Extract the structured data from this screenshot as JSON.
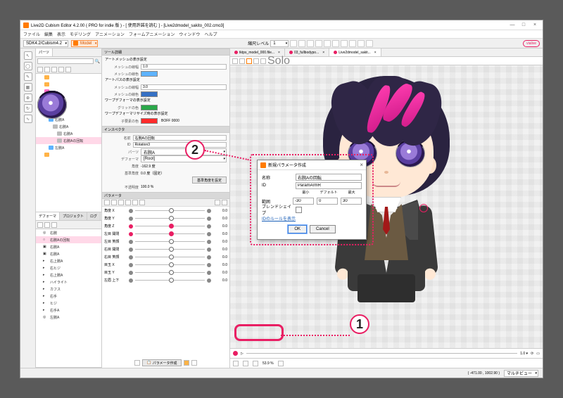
{
  "window": {
    "title": "Live2D Cubism Editor 4.2.00   ( PRO for indie 版 ) - [ 使用許諾を読む ]   - [Live2dmodel_sakito_002.cmo3]",
    "minimize": "—",
    "maximize": "□",
    "close": "×"
  },
  "menu": [
    "ファイル",
    "編集",
    "表示",
    "モデリング",
    "アニメーション",
    "フォームアニメーション",
    "ウィンドウ",
    "ヘルプ"
  ],
  "toolbar": {
    "sdk": "SDK4.2/Cubism4.2",
    "mode": "Model",
    "zoomlabel": "縮尺レベル",
    "zoomval": "1",
    "vialive": "vialive"
  },
  "parts_panel": {
    "tab": "パーツ",
    "search_ph": "",
    "tree": [
      {
        "lbl": "",
        "color": "folder"
      },
      {
        "lbl": "",
        "color": "folder"
      },
      {
        "lbl": "",
        "color": "pink"
      },
      {
        "lbl": "",
        "color": "folder"
      },
      {
        "lbl": "",
        "color": "folder"
      },
      {
        "lbl": "",
        "color": "folder"
      },
      {
        "lbl": "右腕A",
        "color": "blue",
        "indent": 1
      },
      {
        "lbl": "右腕A",
        "color": "gray",
        "indent": 2
      },
      {
        "lbl": "右腕A",
        "color": "gray",
        "indent": 3
      },
      {
        "lbl": "右腕Aの回転",
        "color": "gray",
        "indent": 3,
        "sel": true
      },
      {
        "lbl": "左腕A",
        "color": "blue",
        "indent": 1
      },
      {
        "lbl": "",
        "color": "folder"
      }
    ]
  },
  "deformer_panel": {
    "tabs": [
      "デフォーマ",
      "プロジェクト",
      "ログ"
    ],
    "tree": [
      {
        "lbl": "右腕",
        "ic": "◎"
      },
      {
        "lbl": "右腕Aの回転",
        "ic": "○",
        "sel": true
      },
      {
        "lbl": "右腕A",
        "ic": "▣"
      },
      {
        "lbl": "右腕A",
        "ic": "▣"
      },
      {
        "lbl": "右上腕A",
        "ic": "▸"
      },
      {
        "lbl": "右ヒジ",
        "ic": "▸"
      },
      {
        "lbl": "右上腕A",
        "ic": "▸"
      },
      {
        "lbl": "ハイライト",
        "ic": "▸"
      },
      {
        "lbl": "カフス",
        "ic": "▸"
      },
      {
        "lbl": "右手",
        "ic": "▸"
      },
      {
        "lbl": "ヒジ",
        "ic": "▸"
      },
      {
        "lbl": "右手A",
        "ic": "▸"
      },
      {
        "lbl": "左腕A",
        "ic": "◎"
      }
    ]
  },
  "tooldetail": {
    "title": "ツール詳細",
    "group1": "アートメッシュの表示設定",
    "rows1": [
      {
        "k": "メッシュの線幅",
        "v": "1.0"
      },
      {
        "k": "メッシュの線色",
        "v": ""
      }
    ],
    "group2": "アートパスの表示設定",
    "rows2": [
      {
        "k": "メッシュの線幅",
        "v": "3.0"
      },
      {
        "k": "メッシュの線色",
        "v": ""
      }
    ],
    "group3": "ワープデフォーマの表示設定",
    "rows3": [
      {
        "k": "グリッドの色",
        "v": ""
      }
    ],
    "group4": "ワープデフォーマリサイズ時の表示設定",
    "rows4": [
      {
        "k": "子要素の色",
        "v": "#bff000",
        "hex": "BOFF 0000"
      }
    ]
  },
  "inspector": {
    "title": "インスペクタ",
    "rows": [
      {
        "k": "名前",
        "v": "右腕Aの回転"
      },
      {
        "k": "ID",
        "v": "Rotation3"
      },
      {
        "k": "パーツ",
        "v": "右腕A"
      },
      {
        "k": "デフォーマ",
        "v": "[Root]"
      },
      {
        "k": "角度",
        "v": "-162.9 度"
      },
      {
        "k": "基準角度",
        "v": "0.0 度（固定）"
      }
    ],
    "btn": "基準角度を設定",
    "opacity_k": "不透明度",
    "opacity_v": "100.0 %"
  },
  "parameters": {
    "title": "パラメータ",
    "rows": [
      {
        "n": "角度 X",
        "v": "0.0",
        "red": false
      },
      {
        "n": "角度 Y",
        "v": "0.0",
        "red": false
      },
      {
        "n": "角度 Z",
        "v": "0.0",
        "red": true
      },
      {
        "n": "左目 開閉",
        "v": "0.0",
        "red": true
      },
      {
        "n": "左目 笑顔",
        "v": "0.0",
        "red": false
      },
      {
        "n": "右目 開閉",
        "v": "0.0",
        "red": false
      },
      {
        "n": "右目 笑顔",
        "v": "0.0",
        "red": false
      },
      {
        "n": "目玉 X",
        "v": "0.0",
        "red": false
      },
      {
        "n": "目玉 Y",
        "v": "0.0",
        "red": false
      },
      {
        "n": "左眉 上下",
        "v": "0.0",
        "red": false
      }
    ],
    "create_btn": "パラメータ作成"
  },
  "canvas": {
    "tabs": [
      {
        "lbl": "tktps_model_000.file..."
      },
      {
        "lbl": "03_fullbodypo..."
      },
      {
        "lbl": "Live2dmodel_sakit...",
        "active": true
      }
    ],
    "solo": "Solo",
    "zoom": "53.9 %",
    "coords": "( -471.00 , 1002.90 )",
    "multiview": "マルチビュー"
  },
  "dialog": {
    "title": "新規パラメータ作成",
    "name_k": "名称",
    "name_v": "右腕Aの回転",
    "id_k": "ID",
    "id_v": "ParamArmR",
    "range_k": "範囲",
    "min_h": "最小",
    "def_h": "デフォルト",
    "max_h": "最大",
    "min_v": "-30",
    "def_v": "0",
    "max_v": "30",
    "blend_k": "ブレンドシェイプ",
    "idrule": "IDのルールを表示",
    "ok": "OK",
    "cancel": "Cancel"
  },
  "callouts": {
    "one": "1",
    "two": "2"
  }
}
